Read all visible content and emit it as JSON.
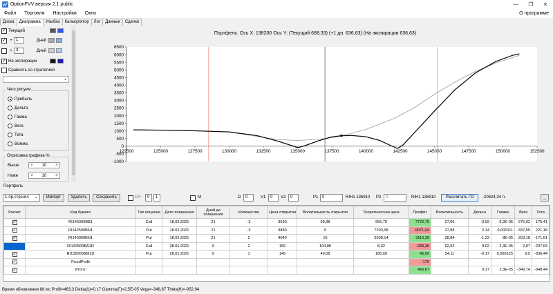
{
  "window": {
    "title": "OptionFVV версия 2.1 public",
    "minimize": "—",
    "maximize": "❐",
    "close": "✕"
  },
  "menu": {
    "items": [
      "Файл",
      "Торговля",
      "Настройки",
      "Окно"
    ],
    "about": "О программе"
  },
  "tabs": [
    "Доска",
    "Диаграмма",
    "Улыбка",
    "Калькулятор",
    "Лог",
    "Данные",
    "Сделки"
  ],
  "active_tab": "Диаграмма",
  "left": {
    "current": "Текущий",
    "plus": "+",
    "days": "Дней",
    "plus_days_1": "1",
    "plus_days_2": "3",
    "expiry": "На экспирации",
    "compare": "Сравнить со стратегией",
    "what_title": "Чего рисуем",
    "radios": [
      "Прибыль",
      "Дельта",
      "Гамма",
      "Вега",
      "Тета",
      "Вомма"
    ],
    "selected_radio": "Прибыль",
    "draw_title": "Отрисовка графика %",
    "above": "Выше",
    "below": "Ниже",
    "above_val": "10",
    "below_val": "10",
    "spin_up": "˄",
    "spin_down": "˅",
    "combo_arrow": "⌄",
    "check_mark": "✓",
    "swatches": [
      [
        "#555555",
        "#3355ff"
      ],
      [
        "#aaaaaa",
        "#88aaff"
      ],
      [
        "#cccccc",
        "#aaccff"
      ],
      [
        "#111111",
        "#1a1aaa"
      ]
    ]
  },
  "chart_title": "Портфель:  Ось X: 138200  Ось Y:   (Текущий 688,33)  (+1 дн. 636,63)   (На экспирации 636,63)",
  "chart_data": {
    "type": "line",
    "title": "Портфель:  Ось X: 138200  Ось Y:   (Текущий 688,33)  (+1 дн. 636,63)   (На экспирации 636,63)",
    "xlim": [
      122500,
      152500
    ],
    "ylim": [
      -1000,
      6500
    ],
    "xticks": [
      122500,
      125000,
      127500,
      130000,
      132500,
      135000,
      137500,
      140000,
      142500,
      145000,
      147500,
      150000,
      152500
    ],
    "yticks": [
      -1000,
      -500,
      0,
      500,
      1000,
      1500,
      2000,
      2500,
      3000,
      3500,
      4000,
      4500,
      5000,
      5500,
      6000,
      6500
    ],
    "cursor_x": 138200,
    "cursor_y": 688.33,
    "vline_black": 137000,
    "vlines_red": [
      128500,
      145200
    ],
    "series": [
      {
        "color": "#111111",
        "points": [
          [
            123000,
            1070
          ],
          [
            125000,
            1050
          ],
          [
            127500,
            1010
          ],
          [
            130000,
            940
          ],
          [
            132000,
            700
          ],
          [
            133500,
            350
          ],
          [
            134500,
            60
          ],
          [
            135000,
            -90
          ],
          [
            135500,
            20
          ],
          [
            136500,
            350
          ],
          [
            137500,
            610
          ],
          [
            138200,
            688
          ],
          [
            139000,
            700
          ],
          [
            140000,
            620
          ],
          [
            141000,
            380
          ],
          [
            141800,
            50
          ],
          [
            142300,
            -150
          ],
          [
            142700,
            80
          ],
          [
            143500,
            850
          ],
          [
            145000,
            2300
          ],
          [
            146500,
            3700
          ],
          [
            148000,
            4800
          ],
          [
            149500,
            5550
          ],
          [
            150700,
            5950
          ],
          [
            151200,
            6050
          ]
        ]
      },
      {
        "color": "#9a9a9a",
        "points": [
          [
            123000,
            1080
          ],
          [
            125000,
            1055
          ],
          [
            127500,
            1010
          ],
          [
            130000,
            920
          ],
          [
            132000,
            650
          ],
          [
            133500,
            440
          ],
          [
            135000,
            380
          ],
          [
            136500,
            450
          ],
          [
            138000,
            620
          ],
          [
            140000,
            1100
          ],
          [
            142000,
            1800
          ],
          [
            143500,
            2500
          ],
          [
            145000,
            3400
          ],
          [
            146500,
            4200
          ],
          [
            148000,
            4900
          ],
          [
            149500,
            5450
          ],
          [
            150700,
            5800
          ],
          [
            151200,
            5950
          ]
        ]
      }
    ]
  },
  "portfolio_label": "Портфель",
  "toolbar": {
    "strategy": "1-пр.стрэнгл",
    "import": "Импорт",
    "delete": "Удалить",
    "save": "Сохранить",
    "dh": "DH",
    "dh_a": "0",
    "dh_b": "1",
    "m": "M",
    "d": "D",
    "d_val": "0",
    "v1": "V1",
    "v1_val": "0",
    "v2": "V2",
    "v2_val": "0",
    "p1": "P1",
    "p1_val": "0",
    "rih1": "RIH1 136910",
    "p2": "P2",
    "p2_val": "0",
    "rih1b": "RIH1 136910",
    "calc": "Рассчитать ГО",
    "go_value": "-20624,34 п.",
    "expand": "_"
  },
  "table": {
    "columns": [
      "Расчет",
      "Код бумаги",
      "Тип опциона",
      "Дата погашения",
      "Дней до погашения",
      "Количество",
      "Цена открытия",
      "Волатильность открытия",
      "Теоретическая цена",
      "Профит",
      "Волатильность",
      "Дельта",
      "Гамма",
      "Вега",
      "Тета",
      "X"
    ],
    "rows": [
      {
        "code": "RI145000BB1",
        "type": "Call",
        "date": "18.02.2021",
        "days": "21",
        "qty": "-3",
        "price": "3530",
        "vol_open": "50,38",
        "theor": "955,75",
        "profit": "7722,75",
        "profit_class": "pos",
        "vol": "27,05",
        "delta": "-0,59",
        "gamma": "-9,3E-05",
        "vega": "-275,92",
        "theta": "175,41",
        "x": "X",
        "sel": false
      },
      {
        "code": "RI142500BN1",
        "type": "Put",
        "date": "18.02.2021",
        "days": "21",
        "qty": "-3",
        "price": "3880",
        "vol_open": "0",
        "theor": "7203,68",
        "profit": "-9971,04",
        "profit_class": "neg",
        "vol": "27,88",
        "delta": "2,14",
        "gamma": "0,000111",
        "vega": "-337,55",
        "theta": "221,18",
        "x": "X",
        "sel": false
      },
      {
        "code": "RI140000BN1",
        "type": "Put",
        "date": "18.02.2021",
        "days": "21",
        "qty": "2",
        "price": "4040",
        "vol_open": "16",
        "theor": "5598,14",
        "profit": "3116,28",
        "profit_class": "pos",
        "vol": "28,84",
        "delta": "-1,23",
        "gamma": "8E-05",
        "vega": "253,18",
        "theta": "-171,61",
        "x": "X",
        "sel": false
      },
      {
        "code": "RI142500BA1D",
        "type": "Call",
        "date": "28.01.2021",
        "days": "0",
        "qty": "2",
        "price": "150",
        "vol_open": "104,88",
        "theor": "8,32",
        "profit": "-283,36",
        "profit_class": "neg",
        "vol": "62,92",
        "delta": "0,02",
        "gamma": "2,3E-05",
        "vega": "2,07",
        "theta": "-237,64",
        "x": "X",
        "sel": true
      },
      {
        "code": "RI135000BM1D",
        "type": "Put",
        "date": "28.01.2021",
        "days": "0",
        "qty": "1",
        "price": "140",
        "vol_open": "49,08",
        "theor": "185,69",
        "profit": "45,69",
        "profit_class": "pos",
        "vol": "54,11",
        "delta": "-0,17",
        "gamma": "0,000125",
        "vega": "9,5",
        "theta": "-936,44",
        "x": "X",
        "sel": false
      },
      {
        "code": "FixedProfit",
        "type": "",
        "date": "",
        "days": "",
        "qty": "",
        "price": "",
        "vol_open": "",
        "theor": "",
        "profit": "-170",
        "profit_class": "neg",
        "vol": "",
        "delta": "",
        "gamma": "",
        "vega": "",
        "theta": "",
        "x": "X",
        "sel": false
      },
      {
        "code": "Итого:",
        "type": "",
        "date": "",
        "days": "",
        "qty": "",
        "price": "",
        "vol_open": "",
        "theor": "",
        "profit": "466,67",
        "profit_class": "pos",
        "vol": "",
        "delta": "0,17",
        "gamma": "2,3E-05",
        "vega": "-349,74",
        "theta": "-948,44",
        "x": "X",
        "sel": false
      }
    ]
  },
  "status": "Время обновления 88 мс  Profit=463,3 Delta(Δ)=0,17 Gamma(Γ)=2,5E-05 Vega=-348,87 Theta(θ)=-952,94"
}
